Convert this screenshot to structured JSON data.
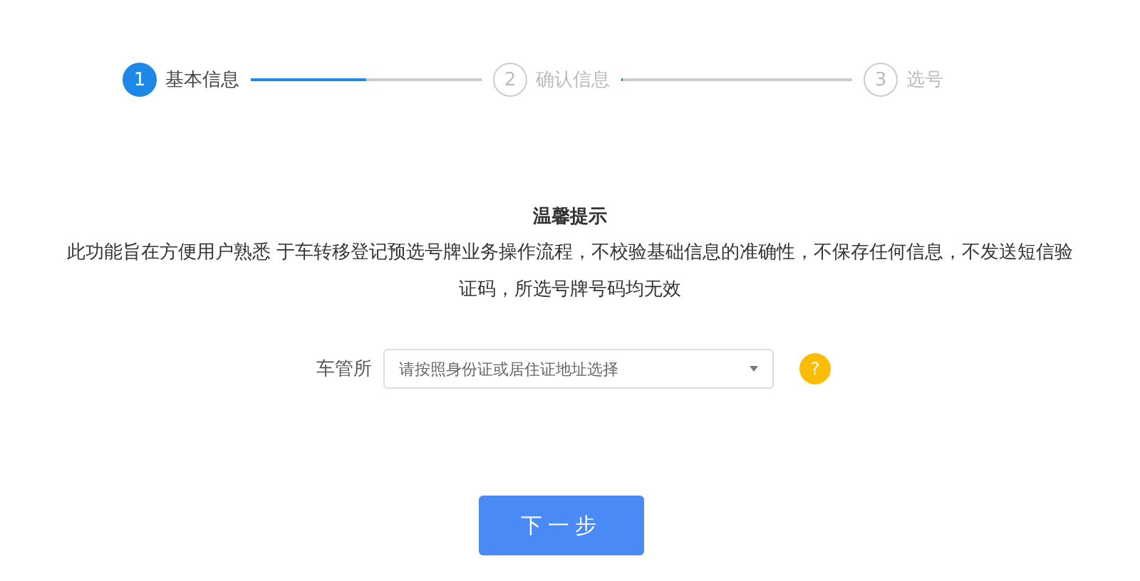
{
  "steps": [
    {
      "number": "1",
      "label": "基本信息",
      "selected": true
    },
    {
      "number": "2",
      "label": "确认信息",
      "selected": false
    },
    {
      "number": "3",
      "label": "选号",
      "selected": false
    }
  ],
  "connectors": [
    {
      "level": 0.5
    },
    {
      "level": 0
    }
  ],
  "notice": {
    "title": "温馨提示",
    "text": "此功能旨在方便用户熟悉 于车转移登记预选号牌业务操作流程，不校验基础信息的准确性，不保存任何信息，不发送短信验证码，所选号牌号码均无效"
  },
  "form": {
    "label": "车管所",
    "placeholder": "请按照身份证或居住证地址选择",
    "help": "?"
  },
  "button": "下一步"
}
